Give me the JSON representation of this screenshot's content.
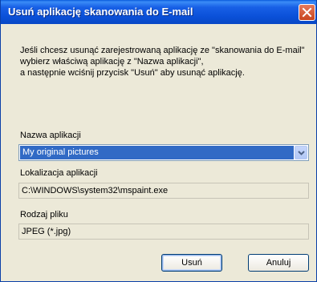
{
  "window": {
    "title": "Usuń aplikację skanowania do E-mail",
    "close_label": "close"
  },
  "description": {
    "line1": "Jeśli chcesz usunąć zarejestrowaną aplikację ze \"skanowania do E-mail\"",
    "line2": "wybierz właściwą aplikację z \"Nazwa aplikacji\",",
    "line3": "a następnie wciśnij przycisk \"Usuń\" aby usunąć aplikację."
  },
  "app_name": {
    "label": "Nazwa aplikacji",
    "selected": "My original pictures"
  },
  "location": {
    "label": "Lokalizacja aplikacji",
    "value": "C:\\WINDOWS\\system32\\mspaint.exe"
  },
  "file_type": {
    "label": "Rodzaj pliku",
    "value": "JPEG (*.jpg)"
  },
  "buttons": {
    "delete": "Usuń",
    "cancel": "Anuluj"
  },
  "colors": {
    "titlebar": "#0a50d8",
    "selection": "#316ac5",
    "dialog_bg": "#ece9d8",
    "close_button": "#c8451f"
  }
}
